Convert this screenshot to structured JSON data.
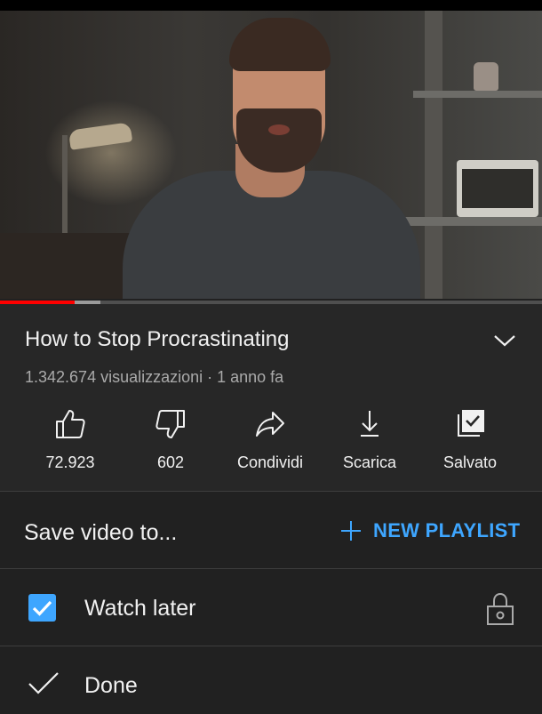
{
  "video": {
    "progress_fraction": 0.138,
    "buffered_fraction": 0.185
  },
  "details": {
    "title": "How to Stop Procrastinating",
    "views_line": "1.342.674 visualizzazioni · 1 anno fa",
    "actions": [
      {
        "icon": "thumbs-up-icon",
        "label": "72.923"
      },
      {
        "icon": "thumbs-down-icon",
        "label": "602"
      },
      {
        "icon": "share-icon",
        "label": "Condividi"
      },
      {
        "icon": "download-icon",
        "label": "Scarica"
      },
      {
        "icon": "saved-playlist-icon",
        "label": "Salvato"
      }
    ]
  },
  "save_sheet": {
    "title": "Save video to...",
    "new_playlist_label": "NEW PLAYLIST",
    "playlists": [
      {
        "name": "Watch later",
        "checked": true,
        "privacy_icon": "lock-icon"
      }
    ],
    "done_label": "Done"
  },
  "colors": {
    "accent_blue": "#3ea6ff",
    "progress_red": "#ff0000",
    "panel_background": "#272727",
    "sheet_background": "#212121"
  }
}
